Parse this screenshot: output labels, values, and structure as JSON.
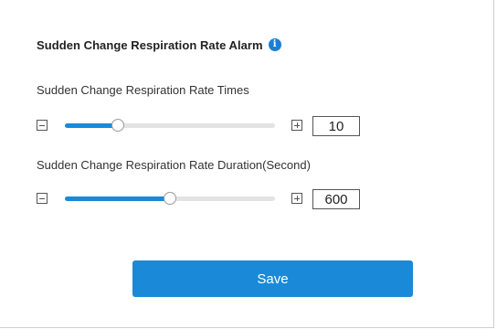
{
  "section": {
    "title": "Sudden Change Respiration Rate Alarm",
    "info_icon": "info-icon"
  },
  "settings": [
    {
      "label": "Sudden Change Respiration Rate Times",
      "value": "10",
      "slider_position": 0.25,
      "decrease_icon": "minus-square-icon",
      "increase_icon": "plus-square-icon"
    },
    {
      "label": "Sudden Change Respiration Rate Duration(Second)",
      "value": "600",
      "slider_position": 0.5,
      "decrease_icon": "minus-square-icon",
      "increase_icon": "plus-square-icon"
    }
  ],
  "actions": {
    "save_label": "Save"
  },
  "colors": {
    "accent": "#1a8ad8",
    "info_icon": "#1a7fd4",
    "track": "#e3e3e3"
  }
}
